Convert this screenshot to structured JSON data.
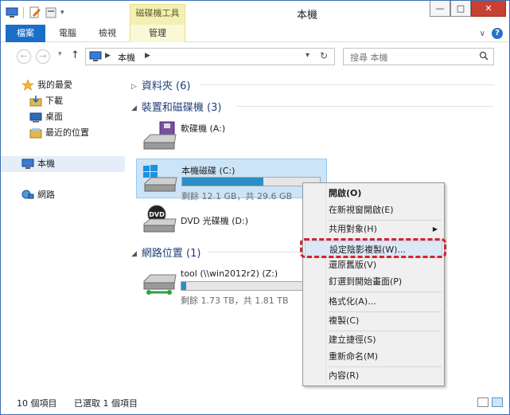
{
  "window": {
    "title": "本機",
    "context_tab_title": "磁碟機工具",
    "minimize": "—",
    "maximize": "□",
    "close": "✕"
  },
  "ribbon": {
    "tabs": [
      "檔案",
      "電腦",
      "檢視",
      "管理"
    ]
  },
  "address_bar": {
    "back": "←",
    "forward": "→",
    "up": "↑",
    "path": [
      "本機"
    ],
    "search_placeholder": "搜尋 本機"
  },
  "sidebar": {
    "items": [
      {
        "label": "我的最愛",
        "icon": "star-icon"
      },
      {
        "label": "下載",
        "icon": "downloads-icon"
      },
      {
        "label": "桌面",
        "icon": "desktop-icon"
      },
      {
        "label": "最近的位置",
        "icon": "recent-icon"
      },
      {
        "label": "本機",
        "icon": "computer-icon",
        "selected": true
      },
      {
        "label": "網路",
        "icon": "network-icon"
      }
    ]
  },
  "content": {
    "groups": [
      {
        "label": "資料夾 (6)"
      },
      {
        "label": "裝置和磁碟機 (3)"
      },
      {
        "label": "網路位置 (1)"
      }
    ],
    "drives": [
      {
        "name": "軟碟機 (A:)",
        "icon": "floppy-drive-icon"
      },
      {
        "name": "本機磁碟 (C:)",
        "icon": "windows-drive-icon",
        "free_text": "剩餘 12.1 GB，共 29.6 GB",
        "used_fraction": 0.59,
        "selected": true
      },
      {
        "name": "DVD 光碟機 (D:)",
        "icon": "dvd-drive-icon"
      },
      {
        "name": "tool (\\\\win2012r2) (Z:)",
        "icon": "network-drive-icon",
        "free_text": "剩餘 1.73 TB，共 1.81 TB",
        "used_fraction": 0.04
      }
    ]
  },
  "context_menu": {
    "items": [
      {
        "label": "開啟(O)",
        "bold": true
      },
      {
        "label": "在新視窗開啟(E)"
      },
      {
        "label": "共用對象(H)",
        "submenu": true
      },
      {
        "label": "設定陰影複製(W)...",
        "highlighted": true
      },
      {
        "label": "還原舊版(V)"
      },
      {
        "label": "釘選到開始畫面(P)"
      },
      {
        "label": "格式化(A)..."
      },
      {
        "label": "複製(C)"
      },
      {
        "label": "建立捷徑(S)"
      },
      {
        "label": "重新命名(M)"
      },
      {
        "label": "內容(R)"
      }
    ]
  },
  "status": {
    "count": "10 個項目",
    "selected": "已選取 1 個項目"
  },
  "colors": {
    "accent": "#1a6ec8",
    "context_tab": "#f4f0b4",
    "selection": "#cce4f7",
    "highlight_border": "#d8232a",
    "drive_bar": "#2b8ec4"
  }
}
